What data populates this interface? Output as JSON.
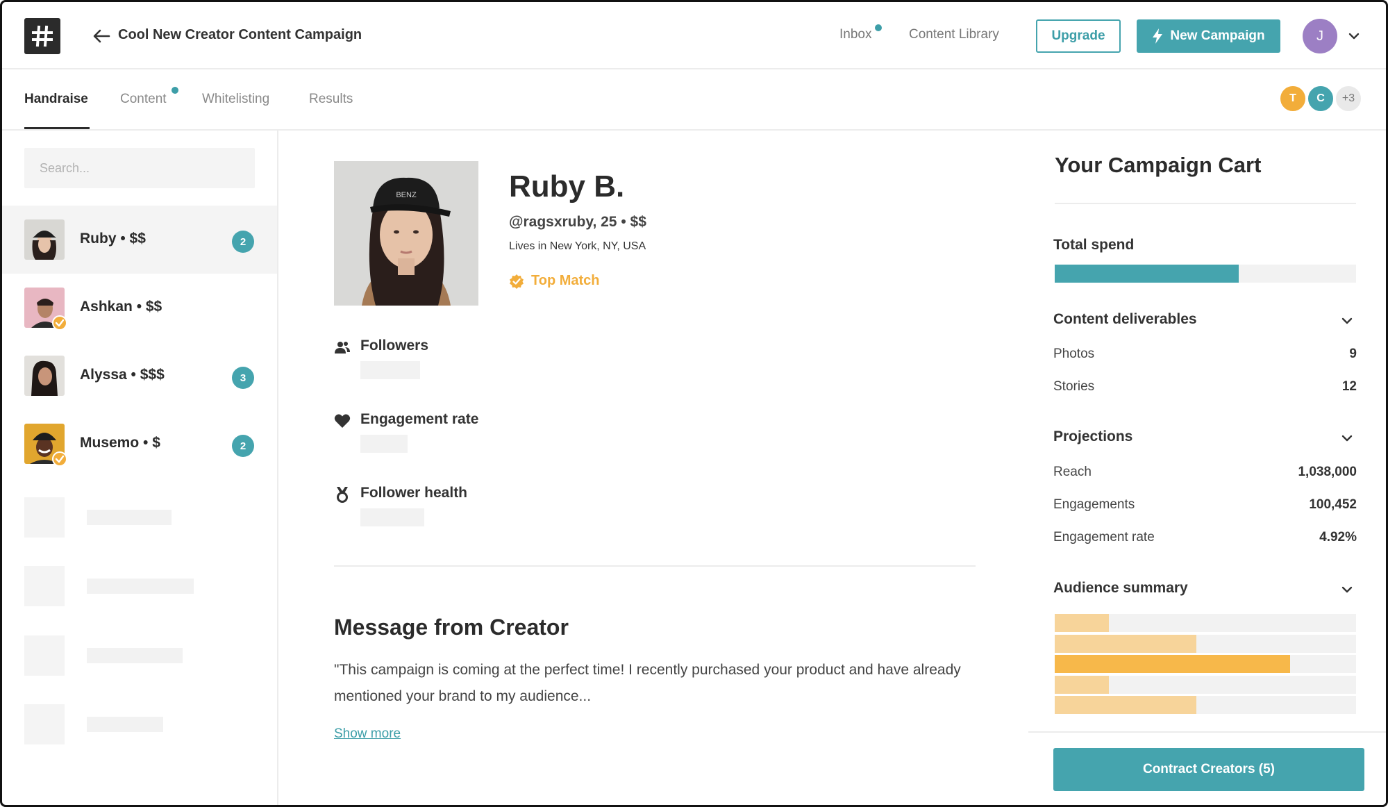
{
  "header": {
    "campaign_title": "Cool New Creator Content Campaign",
    "nav": [
      {
        "label": "Inbox",
        "has_notification": true
      },
      {
        "label": "Content Library"
      }
    ],
    "upgrade_label": "Upgrade",
    "new_campaign_label": "New Campaign",
    "user_initial": "J",
    "colors": {
      "accent": "#45a4ae",
      "user_avatar": "#9c7fc4"
    }
  },
  "tabs": [
    {
      "label": "Handraise",
      "active": true
    },
    {
      "label": "Content",
      "has_notification": true
    },
    {
      "label": "Whitelisting"
    },
    {
      "label": "Results"
    }
  ],
  "collaborators": [
    {
      "initial": "T",
      "color": "#f2ad3a"
    },
    {
      "initial": "C",
      "color": "#45a4ae"
    },
    {
      "initial": "+3",
      "color": "#e9e9e9"
    }
  ],
  "sidebar": {
    "search_placeholder": "Search...",
    "creators": [
      {
        "name": "Ruby • $$",
        "badge": "2",
        "selected": true,
        "verified": false
      },
      {
        "name": "Ashkan • $$",
        "badge": null,
        "selected": false,
        "verified": true
      },
      {
        "name": "Alyssa • $$$",
        "badge": "3",
        "selected": false,
        "verified": false
      },
      {
        "name": "Musemo • $",
        "badge": "2",
        "selected": false,
        "verified": true
      }
    ]
  },
  "profile": {
    "name": "Ruby B.",
    "handle": "@ragsxruby, 25 • $$",
    "location": "Lives in New York, NY, USA",
    "match_label": "Top Match",
    "stats": [
      {
        "label": "Followers",
        "icon": "users-icon"
      },
      {
        "label": "Engagement rate",
        "icon": "heart-icon"
      },
      {
        "label": "Follower health",
        "icon": "medal-icon"
      }
    ],
    "message_title": "Message from Creator",
    "message_body": "\"This campaign is coming at the perfect time! I recently purchased your product and have already mentioned your brand to my audience...",
    "show_more_label": "Show more"
  },
  "cart": {
    "title": "Your Campaign Cart",
    "total_spend_label": "Total spend",
    "total_spend_fraction": 0.61,
    "deliverables": {
      "heading": "Content deliverables",
      "items": [
        {
          "label": "Photos",
          "value": "9"
        },
        {
          "label": "Stories",
          "value": "12"
        }
      ]
    },
    "projections": {
      "heading": "Projections",
      "items": [
        {
          "label": "Reach",
          "value": "1,038,000"
        },
        {
          "label": "Engagements",
          "value": "100,452"
        },
        {
          "label": "Engagement rate",
          "value": "4.92%"
        }
      ]
    },
    "audience": {
      "heading": "Audience summary",
      "bars": [
        {
          "fraction": 0.18,
          "color": "#f7d49a"
        },
        {
          "fraction": 0.47,
          "color": "#f7d49a"
        },
        {
          "fraction": 0.78,
          "color": "#f7b84a"
        },
        {
          "fraction": 0.18,
          "color": "#f7d49a"
        },
        {
          "fraction": 0.47,
          "color": "#f7d49a"
        }
      ]
    },
    "contract_label": "Contract Creators (5)"
  }
}
